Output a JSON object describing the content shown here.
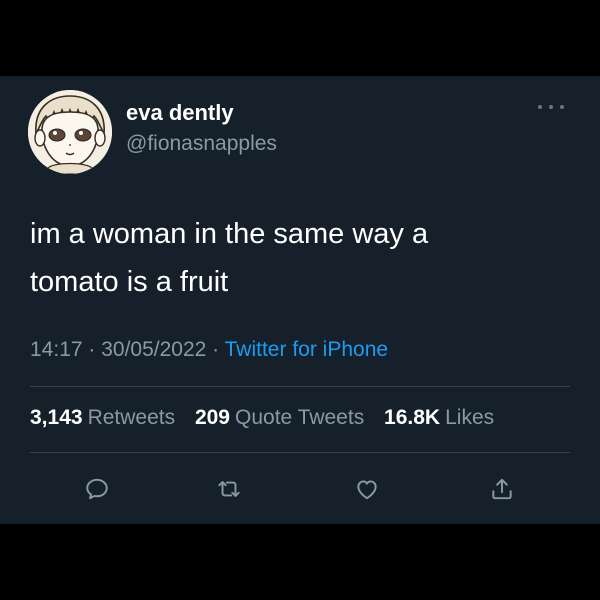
{
  "tweet": {
    "author": {
      "display_name": "eva dently",
      "handle": "@fionasnapples"
    },
    "text_lines": [
      "im a woman in the same way a",
      "tomato is a fruit"
    ],
    "meta": {
      "time": "14:17",
      "separator": " · ",
      "date": "30/05/2022",
      "source": "Twitter for iPhone"
    },
    "stats": [
      {
        "value": "3,143",
        "label": "Retweets"
      },
      {
        "value": "209",
        "label": "Quote Tweets"
      },
      {
        "value": "16.8K",
        "label": "Likes"
      }
    ],
    "actions": [
      "reply-icon",
      "retweet-icon",
      "like-icon",
      "share-icon"
    ]
  },
  "colors": {
    "background": "#15202b",
    "text": "#ffffff",
    "secondary": "#8b98a5",
    "link": "#1d9bf0",
    "divider": "#38444d"
  }
}
